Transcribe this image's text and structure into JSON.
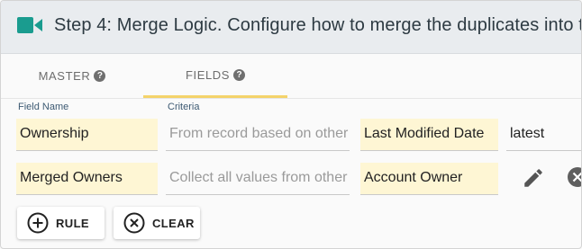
{
  "header": {
    "title": "Step 4: Merge Logic. Configure how to merge the duplicates into t",
    "icon": "video-camera-icon",
    "icon_color": "#1a9c8f"
  },
  "tabs": [
    {
      "label": "MASTER",
      "help": "?"
    },
    {
      "label": "FIELDS",
      "help": "?"
    }
  ],
  "columns": {
    "field_name": "Field Name",
    "criteria": "Criteria"
  },
  "rows": [
    {
      "field": "Ownership",
      "criteria_placeholder": "From record based on other",
      "based_on": "Last Modified Date",
      "value": "latest"
    },
    {
      "field": "Merged Owners",
      "criteria_placeholder": "Collect all values from other",
      "based_on": "Account Owner",
      "actions": [
        "edit-icon",
        "remove-icon"
      ]
    }
  ],
  "buttons": {
    "rule": "RULE",
    "clear": "CLEAR"
  },
  "colors": {
    "accent": "#f4d36a",
    "field_bg": "#fef6d4"
  }
}
